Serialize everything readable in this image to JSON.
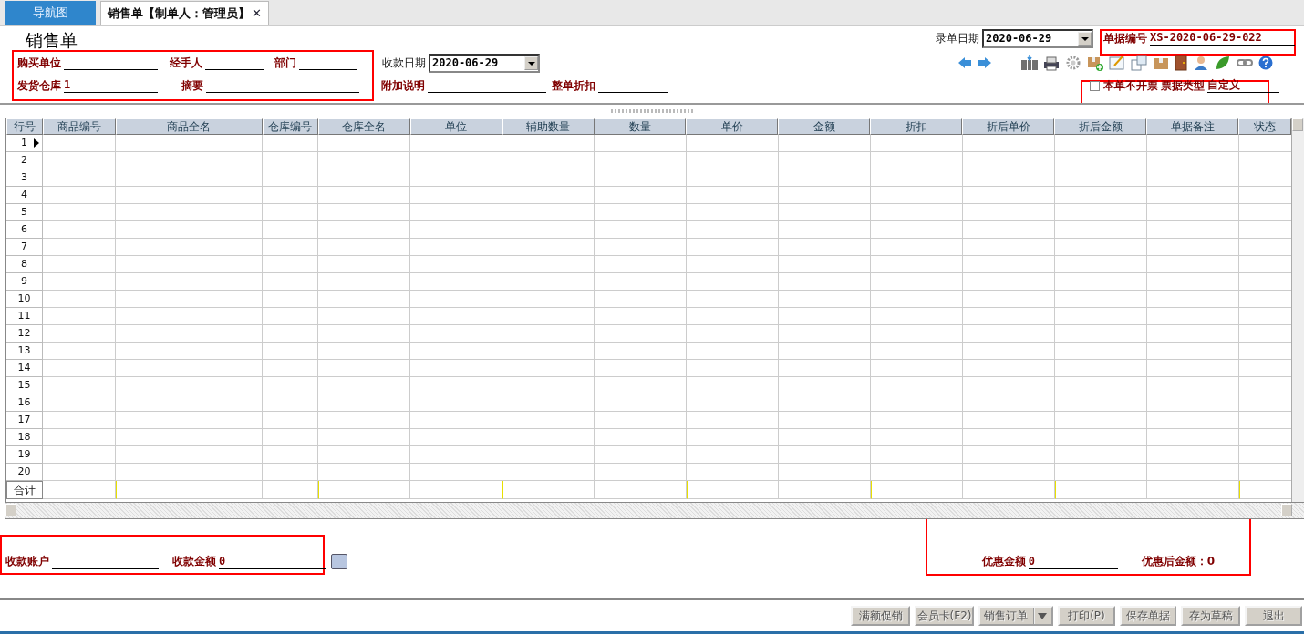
{
  "tabs": [
    {
      "label": "导航图",
      "selected": false,
      "closable": false
    },
    {
      "label": "销售单【制单人：管理员】",
      "selected": true,
      "closable": true
    }
  ],
  "close_glyph": "✕",
  "form_title": "销售单",
  "entry_date": {
    "label": "录单日期",
    "value": "2020-06-29"
  },
  "doc_number": {
    "label": "单据编号",
    "value": "XS-2020-06-29-022"
  },
  "row_one_fields": [
    {
      "label": "购买单位"
    },
    {
      "label": "经手人"
    },
    {
      "label": "部门"
    }
  ],
  "payment_date": {
    "label": "收款日期",
    "value": "2020-06-29"
  },
  "row_two_fields": [
    {
      "label": "发货仓库",
      "value": "1"
    },
    {
      "label": "摘要"
    },
    {
      "label": "附加说明"
    },
    {
      "label": "整单折扣"
    }
  ],
  "no_invoice": {
    "label": "本单不开票",
    "checked": false
  },
  "invoice_type": {
    "label": "票据类型",
    "value": "自定义"
  },
  "grid": {
    "columns": [
      "行号",
      "商品编号",
      "商品全名",
      "仓库编号",
      "仓库全名",
      "单位",
      "辅助数量",
      "数量",
      "单价",
      "金额",
      "折扣",
      "折后单价",
      "折后金额",
      "单据备注",
      "状态"
    ],
    "rows": [
      {
        "no": "1",
        "selected": true
      },
      {
        "no": "2",
        "selected": false
      },
      {
        "no": "3",
        "selected": false
      },
      {
        "no": "4",
        "selected": false
      },
      {
        "no": "5",
        "selected": false
      },
      {
        "no": "6",
        "selected": false
      },
      {
        "no": "7",
        "selected": false
      },
      {
        "no": "8",
        "selected": false
      },
      {
        "no": "9",
        "selected": false
      },
      {
        "no": "10",
        "selected": false
      },
      {
        "no": "11",
        "selected": false
      },
      {
        "no": "12",
        "selected": false
      },
      {
        "no": "13",
        "selected": false
      },
      {
        "no": "14",
        "selected": false
      },
      {
        "no": "15",
        "selected": false
      },
      {
        "no": "16",
        "selected": false
      },
      {
        "no": "17",
        "selected": false
      },
      {
        "no": "18",
        "selected": false
      },
      {
        "no": "19",
        "selected": false
      },
      {
        "no": "20",
        "selected": false
      }
    ],
    "total_label": "合计"
  },
  "payment_account": {
    "label": "收款账户"
  },
  "payment_amount": {
    "label": "收款金额",
    "value": "0"
  },
  "discount_amount": {
    "label": "优惠金额",
    "value": "0"
  },
  "after_discount": "优惠后金额：0",
  "buttons": [
    {
      "label": "满额促销",
      "disabled": true,
      "dropdown": false
    },
    {
      "label": "会员卡(F2)",
      "disabled": true,
      "dropdown": false
    },
    {
      "label": "销售订单",
      "disabled": true,
      "dropdown": true
    },
    {
      "label": "打印(P)",
      "disabled": true,
      "dropdown": false
    },
    {
      "label": "保存单据",
      "disabled": true,
      "dropdown": false
    },
    {
      "label": "存为草稿",
      "disabled": true,
      "dropdown": false
    },
    {
      "label": "退出",
      "disabled": true,
      "dropdown": false
    }
  ]
}
